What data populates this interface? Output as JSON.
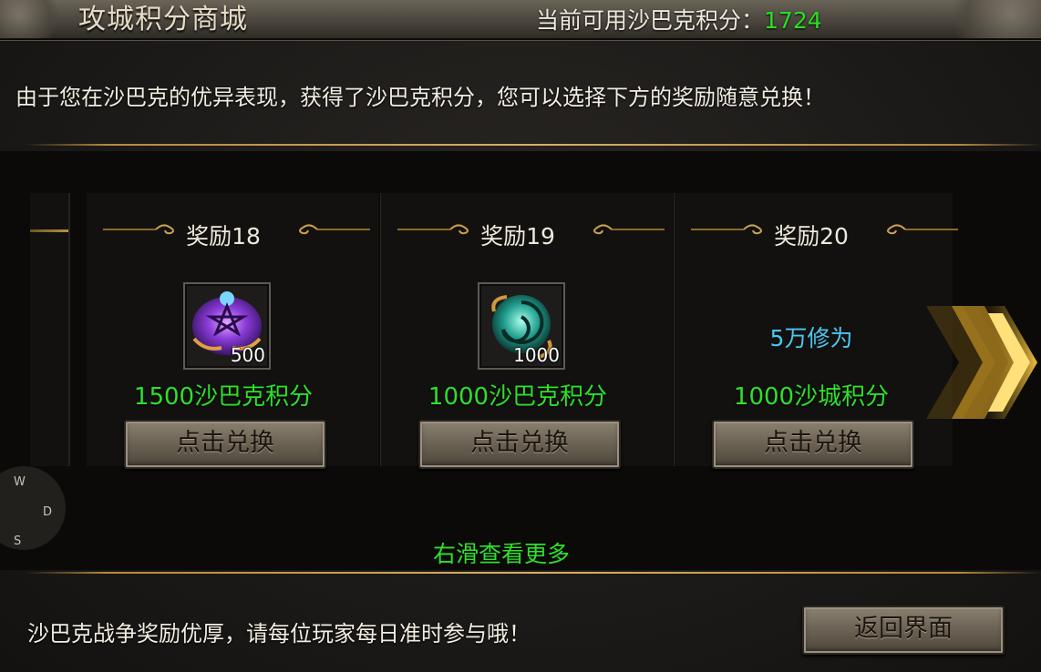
{
  "header": {
    "title": "攻城积分商城",
    "points_label": "当前可用沙巴克积分：",
    "points_value": "1724"
  },
  "description": "由于您在沙巴克的优异表现，获得了沙巴克积分，您可以选择下方的奖励随意兑换！",
  "rewards": [
    {
      "title": "奖励18",
      "item_icon": "purple-rune-crest-icon",
      "item_count": "500",
      "cost": "1500沙巴克积分",
      "button_label": "点击兑换"
    },
    {
      "title": "奖励19",
      "item_icon": "jade-dragon-emblem-icon",
      "item_count": "1000",
      "cost": "1000沙巴克积分",
      "button_label": "点击兑换"
    },
    {
      "title": "奖励20",
      "reward_text": "5万修为",
      "cost": "1000沙城积分",
      "button_label": "点击兑换"
    }
  ],
  "scroll_hint": "右滑查看更多",
  "compass": {
    "w": "W",
    "d": "D",
    "s": "S"
  },
  "footer": {
    "text": "沙巴克战争奖励优厚，请每位玩家每日准时参与哦！",
    "back_button_label": "返回界面"
  },
  "colors": {
    "points_green": "#28e020",
    "cost_green": "#2ee02a",
    "reward_cyan": "#48c8f0",
    "gold_line": "#d8b064",
    "chevron_gold": "#f0c040"
  }
}
